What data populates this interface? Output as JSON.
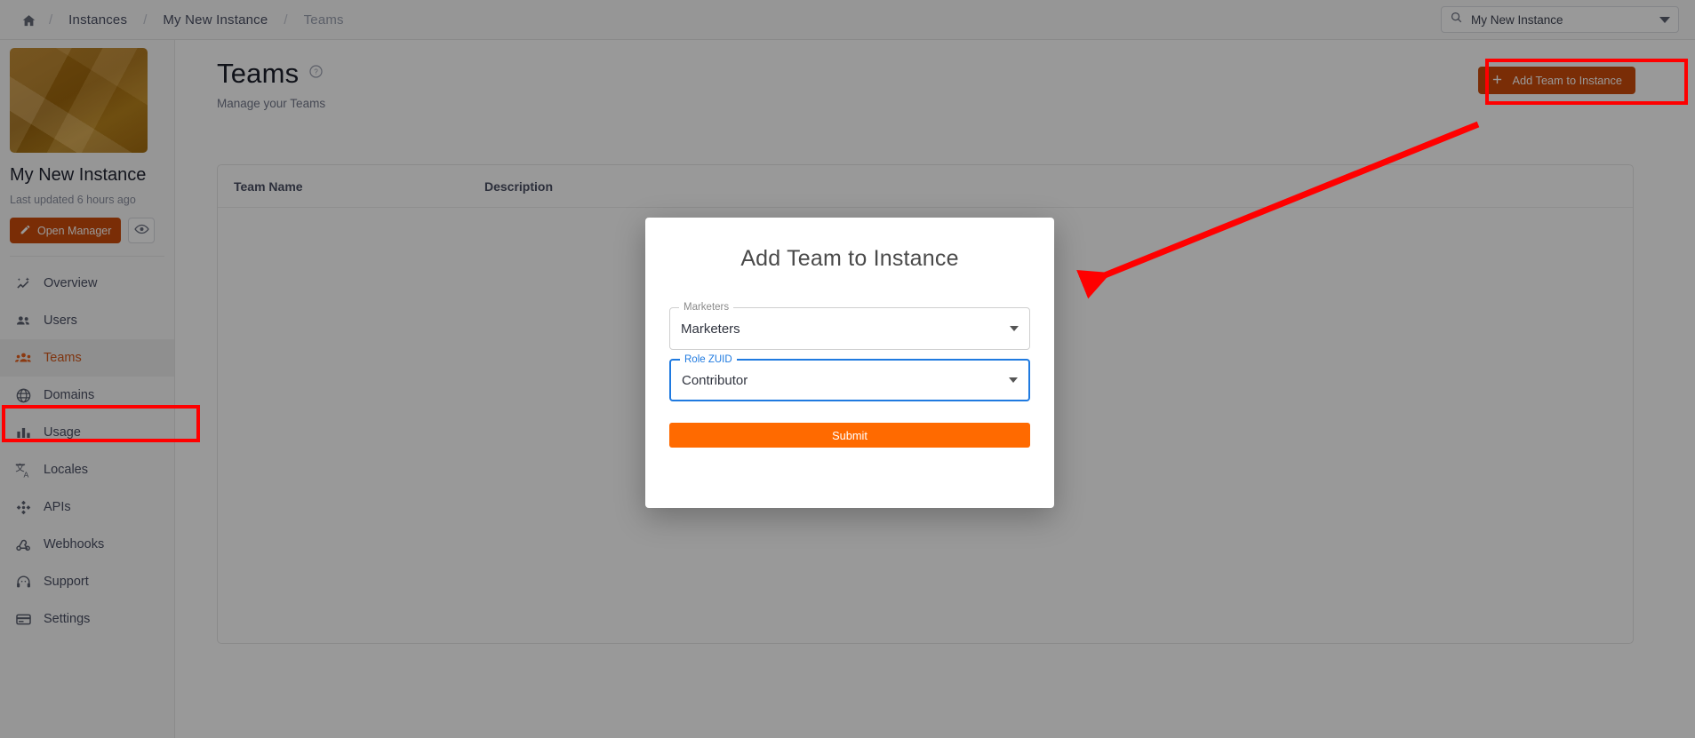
{
  "topbar": {
    "home_icon": "home-icon",
    "breadcrumbs": [
      {
        "label": "Instances",
        "current": false
      },
      {
        "label": "My New Instance",
        "current": false
      },
      {
        "label": "Teams",
        "current": true
      }
    ],
    "separator": "/",
    "search": {
      "icon": "search-icon",
      "value": "My New Instance",
      "placeholder": "My New Instance",
      "chevron": "chevron-down-icon"
    }
  },
  "sidebar": {
    "instance_name": "My New Instance",
    "last_updated": "Last updated 6 hours ago",
    "open_manager_label": "Open Manager",
    "open_manager_icon": "pencil-icon",
    "preview_icon": "eye-icon",
    "thumbnail_name": "instance-thumbnail",
    "items": [
      {
        "label": "Overview",
        "icon": "overview-chart-icon",
        "active": false
      },
      {
        "label": "Users",
        "icon": "users-icon",
        "active": false
      },
      {
        "label": "Teams",
        "icon": "teams-icon",
        "active": true
      },
      {
        "label": "Domains",
        "icon": "globe-icon",
        "active": false
      },
      {
        "label": "Usage",
        "icon": "bar-chart-icon",
        "active": false
      },
      {
        "label": "Locales",
        "icon": "translate-icon",
        "active": false
      },
      {
        "label": "APIs",
        "icon": "apis-icon",
        "active": false
      },
      {
        "label": "Webhooks",
        "icon": "webhook-icon",
        "active": false
      },
      {
        "label": "Support",
        "icon": "headset-icon",
        "active": false
      },
      {
        "label": "Settings",
        "icon": "card-icon",
        "active": false
      }
    ]
  },
  "main": {
    "page_title": "Teams",
    "help_icon": "help-circle-icon",
    "page_subtitle": "Manage your Teams",
    "add_button_label": "Add Team to Instance",
    "add_button_icon": "plus-icon",
    "table": {
      "columns": [
        "Team Name",
        "Description"
      ],
      "rows": []
    }
  },
  "modal": {
    "title": "Add Team to Instance",
    "fields": [
      {
        "legend": "Marketers",
        "value": "Marketers",
        "focused": false,
        "chevron": "chevron-down-icon"
      },
      {
        "legend": "Role ZUID",
        "value": "Contributor",
        "focused": true,
        "chevron": "chevron-down-icon"
      }
    ],
    "submit_label": "Submit"
  },
  "annotations": {
    "color": "#ff0000",
    "highlight_add_button": true,
    "highlight_sidebar_teams": true,
    "arrow_from_add_button_to_modal": true
  },
  "colors": {
    "brand_orange": "#cc4b0a",
    "submit_orange": "#ff6a00",
    "focus_blue": "#1f7ae0",
    "annotation_red": "#ff0000",
    "text_dark": "#1b1f2b",
    "text_muted": "#73798b"
  }
}
